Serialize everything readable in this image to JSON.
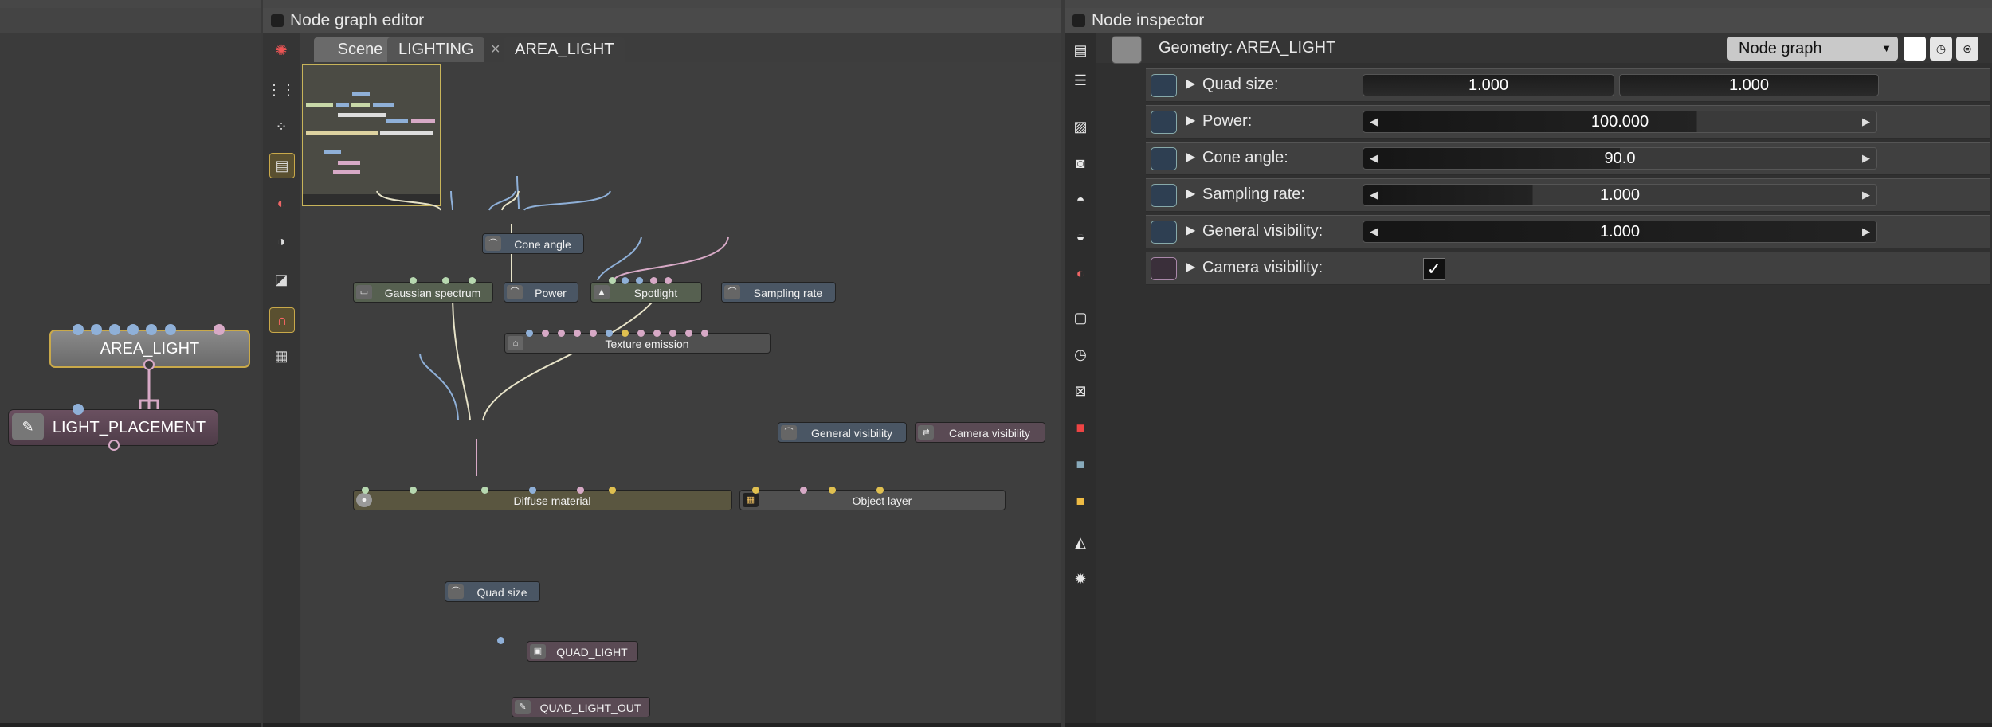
{
  "left_panel": {
    "nodes": [
      {
        "label": "AREA_LIGHT"
      },
      {
        "label": "LIGHT_PLACEMENT"
      }
    ]
  },
  "editor": {
    "title": "Node graph editor",
    "tabs": [
      {
        "label": "Scene"
      },
      {
        "label": "LIGHTING"
      },
      {
        "label": "AREA_LIGHT"
      }
    ],
    "tab_close_glyph": "×",
    "nodes": {
      "cone_angle": "Cone angle",
      "gaussian_spectrum": "Gaussian spectrum",
      "power": "Power",
      "spotlight": "Spotlight",
      "sampling_rate": "Sampling rate",
      "texture_emission": "Texture emission",
      "general_visibility": "General visibility",
      "camera_visibility": "Camera visibility",
      "diffuse_material": "Diffuse material",
      "object_layer": "Object layer",
      "quad_size": "Quad size",
      "quad_light": "QUAD_LIGHT",
      "quad_light_out": "QUAD_LIGHT_OUT"
    },
    "colors": {
      "link": "#e7e3c8",
      "link_blue": "#8fb0d8",
      "link_pink": "#d7a9c6",
      "minimap_border": "#c8b45a"
    }
  },
  "inspector": {
    "title": "Node inspector",
    "node_title": "Geometry: AREA_LIGHT",
    "view_select": "Node graph",
    "params": [
      {
        "label": "Quad size:",
        "values": [
          "1.000",
          "1.000"
        ]
      },
      {
        "label": "Power:",
        "value": "100.000",
        "fill": 0.65
      },
      {
        "label": "Cone angle:",
        "value": "90.0",
        "fill": 0.5
      },
      {
        "label": "Sampling rate:",
        "value": "1.000",
        "fill": 0.33
      },
      {
        "label": "General visibility:",
        "value": "1.000",
        "fill": 1.0
      },
      {
        "label": "Camera visibility:",
        "checked": true,
        "check_glyph": "✓"
      }
    ]
  }
}
